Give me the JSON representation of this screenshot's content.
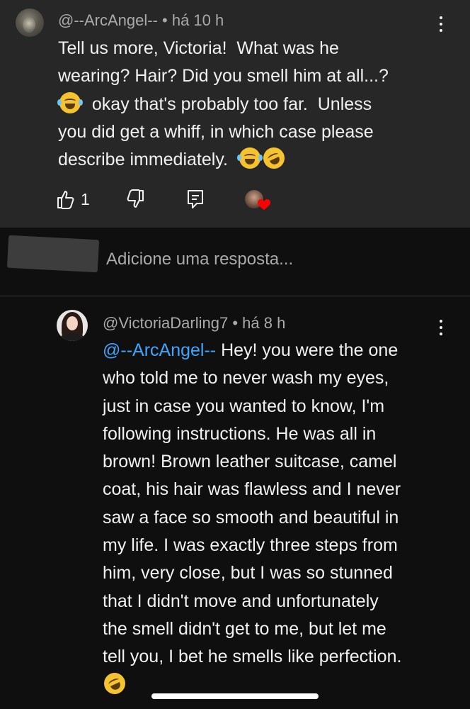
{
  "comment": {
    "author": "@--ArcAngel--",
    "time": "• há 10 h",
    "lines": [
      "Tell us more, Victoria!  What was he",
      "wearing? Hair? Did you smell him at all...?",
      "okay that's probably too far.  Unless",
      "you did get a whiff, in which case please",
      "describe immediately."
    ],
    "like_count": "1",
    "icons": [
      "like-icon",
      "dislike-icon",
      "reply-icon",
      "creator-heart-icon"
    ]
  },
  "reply_box": {
    "placeholder": "Adicione uma resposta..."
  },
  "reply": {
    "author": "@VictoriaDarling7",
    "time": "• há 8 h",
    "mention": "@--ArcAngel--",
    "first_line_rest": " Hey! you were the one",
    "lines": [
      "who told me to never wash my eyes,",
      "just in case you wanted to know, I'm",
      "following instructions. He was all in",
      "brown! Brown leather suitcase, camel",
      "coat, his hair was flawless and I never",
      "saw a face so smooth and beautiful in",
      "my life. I was exactly three steps from",
      "him, very close, but I was so stunned",
      "that I didn't move and unfortunately",
      "the smell didn't get to me, but let me",
      "tell you, I bet he smells like perfection."
    ]
  },
  "colors": {
    "background": "#0f0f0f",
    "comment_background": "#272727",
    "text": "#f1f1f1",
    "secondary_text": "#aaaaaa",
    "mention": "#3ea6ff",
    "heart": "#ff0000"
  }
}
